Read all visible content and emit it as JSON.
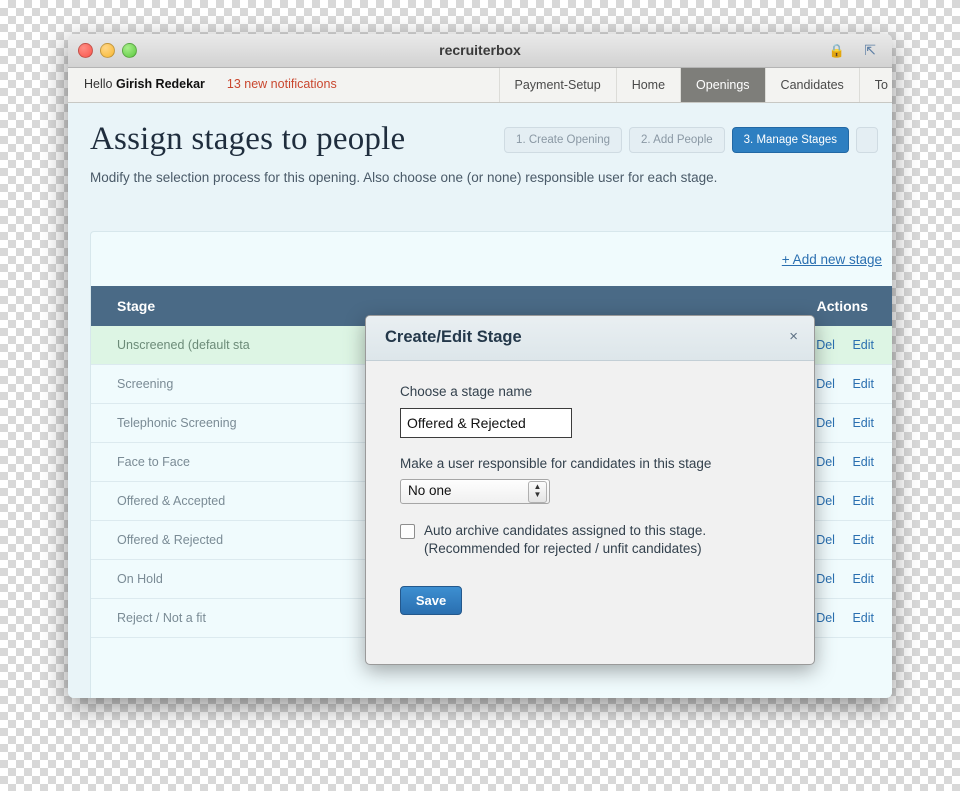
{
  "window": {
    "title": "recruiterbox",
    "lock_icon": "lock-icon",
    "expand_icon": "expand-icon"
  },
  "nav": {
    "greeting_prefix": "Hello ",
    "greeting_name": "Girish Redekar",
    "notifications": "13 new notifications",
    "items": [
      {
        "label": "Payment-Setup",
        "active": false
      },
      {
        "label": "Home",
        "active": false
      },
      {
        "label": "Openings",
        "active": true
      },
      {
        "label": "Candidates",
        "active": false
      },
      {
        "label": "To",
        "active": false
      }
    ]
  },
  "page": {
    "title": "Assign stages to people",
    "subtitle": "Modify the selection process for this opening. Also choose one (or none) responsible user for each stage.",
    "steps": [
      {
        "label": "1. Create Opening",
        "active": false
      },
      {
        "label": "2. Add People",
        "active": false
      },
      {
        "label": "3. Manage Stages",
        "active": true
      },
      {
        "label": "",
        "active": false
      }
    ],
    "add_new_stage": "+ Add new stage"
  },
  "table": {
    "headers": {
      "stage": "Stage",
      "actions": "Actions"
    },
    "up_arrow": "↑",
    "down_arrow": "↓",
    "del_label": "Del",
    "edit_label": "Edit",
    "rows": [
      {
        "stage": "Unscreened (default sta"
      },
      {
        "stage": "Screening"
      },
      {
        "stage": "Telephonic Screening"
      },
      {
        "stage": "Face to Face"
      },
      {
        "stage": "Offered & Accepted"
      },
      {
        "stage": "Offered & Rejected"
      },
      {
        "stage": "On Hold"
      },
      {
        "stage": "Reject / Not a fit"
      }
    ]
  },
  "modal": {
    "title": "Create/Edit Stage",
    "close": "×",
    "name_label": "Choose a stage name",
    "name_value": "Offered & Rejected",
    "responsible_label": "Make a user responsible for candidates in this stage",
    "responsible_value": "No one",
    "auto_archive_line1": "Auto archive candidates assigned to this stage.",
    "auto_archive_line2": "(Recommended for rejected / unfit candidates)",
    "save_label": "Save"
  }
}
